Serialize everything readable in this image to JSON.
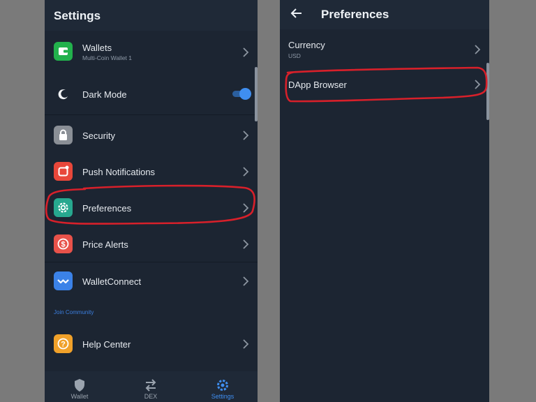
{
  "settings": {
    "title": "Settings",
    "items": [
      {
        "label": "Wallets",
        "sub": "Multi-Coin Wallet 1",
        "icon": "wallet-icon",
        "color": "#22b14c"
      },
      {
        "label": "Dark Mode",
        "icon": "moon-icon",
        "color": "#1c2532",
        "toggle_on": true
      },
      {
        "label": "Security",
        "icon": "lock-icon",
        "color": "#8a8f96"
      },
      {
        "label": "Push Notifications",
        "icon": "notification-icon",
        "color": "#e8473a"
      },
      {
        "label": "Preferences",
        "icon": "gear-icon",
        "color": "#27a88f"
      },
      {
        "label": "Price Alerts",
        "icon": "dollar-icon",
        "color": "#e8524a"
      },
      {
        "label": "WalletConnect",
        "icon": "walletconnect-icon",
        "color": "#3b82e8"
      }
    ],
    "section_label": "Join Community",
    "help": {
      "label": "Help Center",
      "icon": "question-icon",
      "color": "#f0a12a"
    }
  },
  "bottom_nav": [
    {
      "label": "Wallet",
      "icon": "shield-icon",
      "active": false
    },
    {
      "label": "DEX",
      "icon": "swap-arrows-icon",
      "active": false
    },
    {
      "label": "Settings",
      "icon": "gear-icon",
      "active": true
    }
  ],
  "preferences": {
    "title": "Preferences",
    "items": [
      {
        "label": "Currency",
        "sub": "USD"
      },
      {
        "label": "DApp Browser"
      }
    ]
  },
  "colors": {
    "background": "#1c2532",
    "header": "#1f2937",
    "accent": "#3f8ef0",
    "annotation": "#d8202a"
  }
}
